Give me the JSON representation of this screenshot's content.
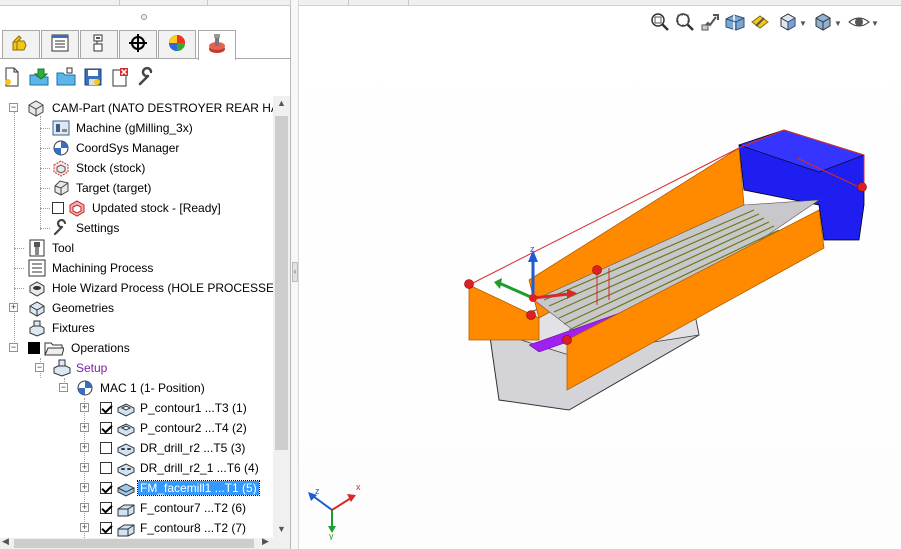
{
  "window": {
    "title": ""
  },
  "manager_tabs": [
    {
      "icon": "feature-manager-icon"
    },
    {
      "icon": "property-manager-icon"
    },
    {
      "icon": "configuration-manager-icon"
    },
    {
      "icon": "dimxpert-manager-icon"
    },
    {
      "icon": "display-manager-icon"
    },
    {
      "icon": "cam-operation-tree-icon",
      "active": true
    }
  ],
  "cam_toolbar": [
    {
      "icon": "new-document-icon"
    },
    {
      "icon": "open-arrow-icon"
    },
    {
      "icon": "open-folder-icon"
    },
    {
      "icon": "save-icon"
    },
    {
      "icon": "close-document-icon"
    },
    {
      "icon": "wrench-icon"
    }
  ],
  "tree": {
    "root": {
      "label": "CAM-Part (NATO DESTROYER REAR HALF_MI",
      "icon": "cam-part-icon"
    },
    "part_items": [
      {
        "label": "Machine (gMilling_3x)",
        "icon": "machine-icon"
      },
      {
        "label": "CoordSys Manager",
        "icon": "coordsys-icon"
      },
      {
        "label": "Stock (stock)",
        "icon": "stock-icon"
      },
      {
        "label": "Target (target)",
        "icon": "target-icon"
      },
      {
        "label": "Updated stock - [Ready]",
        "icon": "updated-stock-icon",
        "checkbox": false
      },
      {
        "label": "Settings",
        "icon": "settings-wrench-icon"
      }
    ],
    "top_items": [
      {
        "label": "Tool",
        "icon": "tool-icon"
      },
      {
        "label": "Machining Process",
        "icon": "machining-process-icon"
      },
      {
        "label": "Hole Wizard Process (HOLE PROCESSES - SOL",
        "icon": "hole-wizard-icon"
      },
      {
        "label": "Geometries",
        "icon": "geometries-icon"
      },
      {
        "label": "Fixtures",
        "icon": "fixtures-icon"
      },
      {
        "label": "Operations",
        "icon": "operations-folder-icon"
      }
    ],
    "setup": {
      "label": "Setup",
      "icon": "setup-icon"
    },
    "mac": {
      "label": "MAC 1 (1- Position)",
      "icon": "coordsys-icon"
    },
    "operations": [
      {
        "label": "P_contour1 ...T3 (1)",
        "checked": true,
        "icon": "profile-op-icon"
      },
      {
        "label": "P_contour2 ...T4 (2)",
        "checked": true,
        "icon": "profile-op-icon"
      },
      {
        "label": "DR_drill_r2 ...T5 (3)",
        "checked": false,
        "icon": "drill-op-icon"
      },
      {
        "label": "DR_drill_r2_1 ...T6 (4)",
        "checked": false,
        "icon": "drill-op-icon"
      },
      {
        "label": "FM_facemill1 ...T1 (5)",
        "checked": true,
        "icon": "facemill-op-icon",
        "selected": true
      },
      {
        "label": "F_contour7 ...T2 (6)",
        "checked": true,
        "icon": "contour-op-icon"
      },
      {
        "label": "F_contour8 ...T2 (7)",
        "checked": true,
        "icon": "contour-op-icon"
      }
    ]
  },
  "heads_up_toolbar": [
    {
      "icon": "zoom-to-fit-icon"
    },
    {
      "icon": "zoom-to-area-icon"
    },
    {
      "icon": "previous-view-icon"
    },
    {
      "icon": "section-view-icon"
    },
    {
      "icon": "dynamic-annotation-icon"
    },
    {
      "icon": "view-orientation-icon",
      "dropdown": true
    },
    {
      "icon": "display-style-icon",
      "dropdown": true
    },
    {
      "icon": "hide-show-items-icon",
      "dropdown": true
    }
  ],
  "triad": {
    "x": "x",
    "y": "y",
    "z": "z"
  },
  "colors": {
    "stock_orange": "#ff8a00",
    "fixture_blue": "#1e1ef0",
    "part_grey": "#d4d4d8",
    "toolpath_green": "#6b7a18",
    "selection_blue": "#3399ff",
    "setup_purple": "#7a1fa2"
  }
}
